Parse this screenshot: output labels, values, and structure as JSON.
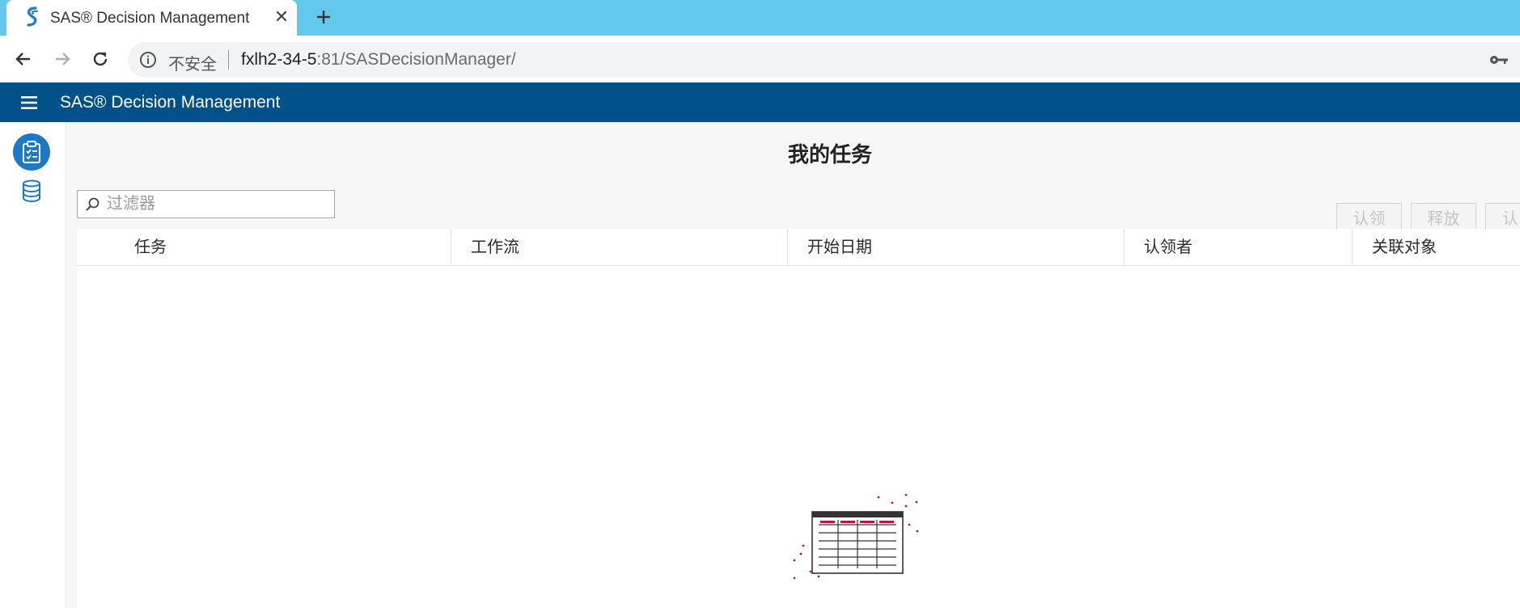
{
  "browser": {
    "tab_title": "SAS® Decision Management",
    "close_glyph": "✕",
    "security_label": "不安全",
    "url_host": "fxlh2-34-5",
    "url_rest": ":81/SASDecisionManager/"
  },
  "app": {
    "title": "SAS® Decision Management",
    "brand_color": "#005089",
    "tab_strip_color": "#62c8ee"
  },
  "rail": {
    "items": [
      {
        "name": "tasks",
        "icon": "clipboard-checklist-icon",
        "active": true
      },
      {
        "name": "data",
        "icon": "database-icon",
        "active": false
      }
    ]
  },
  "page": {
    "title": "我的任务",
    "filter_placeholder": "过滤器",
    "actions": [
      "认领",
      "释放",
      "认"
    ],
    "columns": [
      "任务",
      "工作流",
      "开始日期",
      "认领者",
      "关联对象"
    ]
  }
}
